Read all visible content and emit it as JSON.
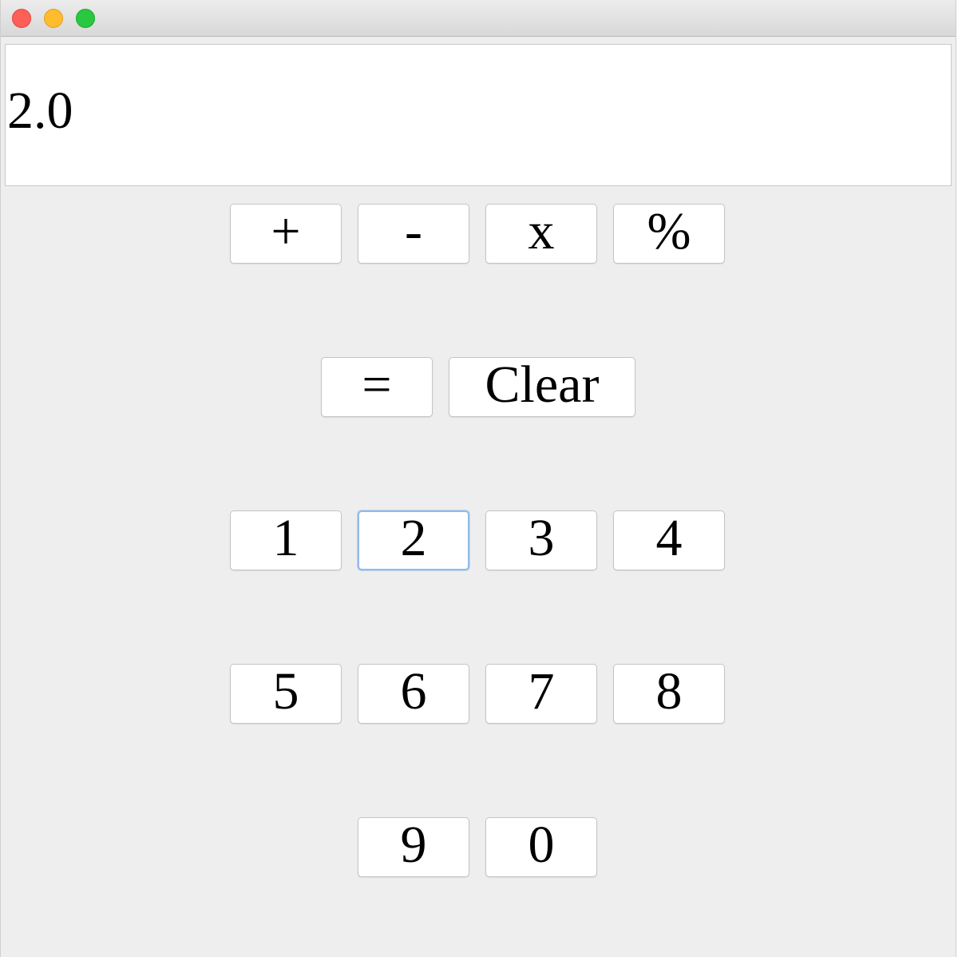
{
  "display": {
    "value": "2.0"
  },
  "operators": {
    "plus": "+",
    "minus": "-",
    "multiply": "x",
    "percent": "%"
  },
  "actions": {
    "equals": "=",
    "clear": "Clear"
  },
  "digits": {
    "d1": "1",
    "d2": "2",
    "d3": "3",
    "d4": "4",
    "d5": "5",
    "d6": "6",
    "d7": "7",
    "d8": "8",
    "d9": "9",
    "d0": "0"
  },
  "colors": {
    "background": "#eeeeee",
    "button": "#ffffff",
    "focus_ring": "#93b9e8",
    "close": "#fe5f57",
    "minimize": "#febc2e",
    "zoom": "#28c840"
  }
}
